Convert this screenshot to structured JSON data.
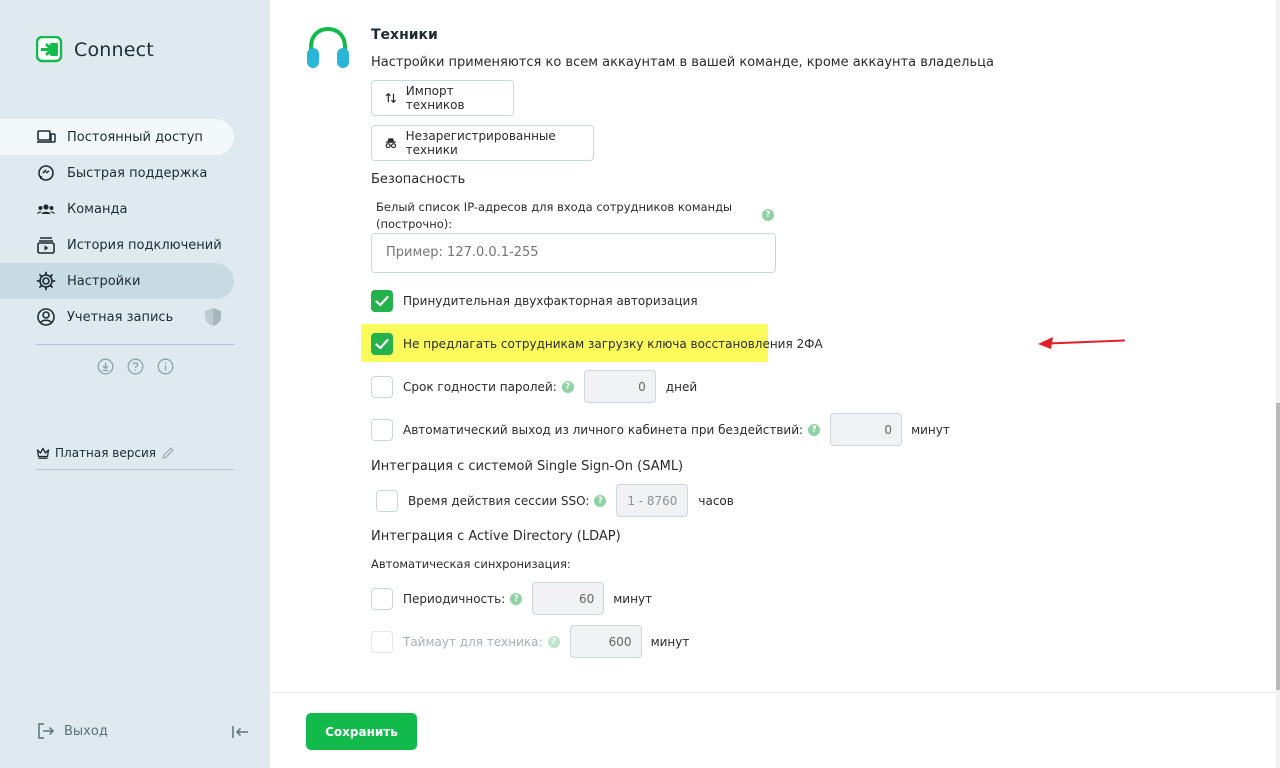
{
  "sidebar": {
    "logo_text": "Connect",
    "items": [
      {
        "label": "Постоянный доступ",
        "icon": "devices-icon"
      },
      {
        "label": "Быстрая поддержка",
        "icon": "support-icon"
      },
      {
        "label": "Команда",
        "icon": "team-icon"
      },
      {
        "label": "История подключений",
        "icon": "history-icon"
      },
      {
        "label": "Настройки",
        "icon": "gear-icon"
      },
      {
        "label": "Учетная запись",
        "icon": "account-icon"
      }
    ],
    "plan_label": "Платная версия",
    "logout_label": "Выход"
  },
  "section": {
    "title": "Техники",
    "description": "Настройки применяются ко всем аккаунтам в вашей команде, кроме аккаунта владельца",
    "import_button": "Импорт техников",
    "unregistered_button": "Незарегистрированные техники"
  },
  "security": {
    "title": "Безопасность",
    "whitelist_label": "Белый список IP-адресов для входа сотрудников команды (построчно):",
    "whitelist_placeholder": "Пример: 127.0.0.1-255",
    "force_2fa_label": "Принудительная двухфакторная авторизация",
    "no_recovery_key_label": "Не предлагать сотрудникам загрузку ключа восстановления 2ФА",
    "password_expiry_label": "Срок годности паролей:",
    "password_expiry_value": "0",
    "password_expiry_unit": "дней",
    "auto_logout_label": "Автоматический выход из личного кабинета при бездействий:",
    "auto_logout_value": "0",
    "auto_logout_unit": "минут"
  },
  "sso": {
    "title": "Интеграция с системой Single Sign-On (SAML)",
    "session_label": "Время действия сессии SSO:",
    "session_placeholder": "1 - 8760",
    "session_unit": "часов"
  },
  "ldap": {
    "title": "Интеграция с Active Directory (LDAP)",
    "auto_sync_label": "Автоматическая синхронизация:",
    "period_label": "Периодичность:",
    "period_value": "60",
    "period_unit": "минут",
    "timeout_label": "Таймаут для техника:",
    "timeout_value": "600",
    "timeout_unit": "минут"
  },
  "footer": {
    "save_label": "Сохранить"
  },
  "colors": {
    "accent": "#12b94b",
    "sidebar_bg": "#deeaf0",
    "highlight": "#fbfb5c",
    "annotation_arrow": "#e0202a"
  }
}
